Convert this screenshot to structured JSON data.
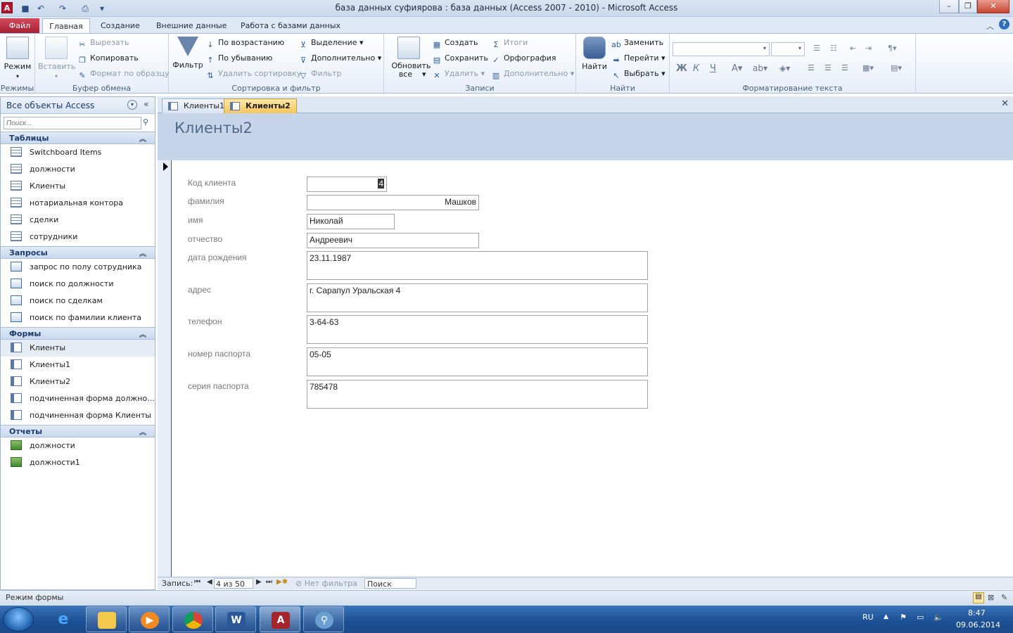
{
  "window": {
    "title": "база данных суфиярова : база данных (Access 2007 - 2010)  -  Microsoft Access",
    "app_icon_letter": "A"
  },
  "ribbon_tabs": [
    "Файл",
    "Главная",
    "Создание",
    "Внешние данные",
    "Работа с базами данных"
  ],
  "ribbon": {
    "views": {
      "label": "Режим",
      "group": "Режимы"
    },
    "clipboard": {
      "paste": "Вставить",
      "cut": "Вырезать",
      "copy": "Копировать",
      "format_painter": "Формат по образцу",
      "group": "Буфер обмена"
    },
    "sort_filter": {
      "filter": "Фильтр",
      "ascending": "По возрастанию",
      "descending": "По убыванию",
      "remove_sort": "Удалить сортировку",
      "selection": "Выделение",
      "advanced": "Дополнительно",
      "toggle_filter": "Фильтр",
      "group": "Сортировка и фильтр"
    },
    "records": {
      "refresh": "Обновить все",
      "new": "Создать",
      "save": "Сохранить",
      "delete": "Удалить",
      "totals": "Итоги",
      "spelling": "Орфография",
      "more": "Дополнительно",
      "group": "Записи"
    },
    "find": {
      "find": "Найти",
      "replace": "Заменить",
      "goto": "Перейти",
      "select": "Выбрать",
      "group": "Найти"
    },
    "text_format": {
      "bold": "Ж",
      "italic": "К",
      "underline": "Ч",
      "group": "Форматирование текста"
    }
  },
  "nav": {
    "title": "Все объекты Access",
    "search_placeholder": "Поиск...",
    "groups": [
      {
        "label": "Таблицы",
        "items": [
          "Switchboard Items",
          "должности",
          "Клиенты",
          "нотариальная контора",
          "сделки",
          "сотрудники"
        ]
      },
      {
        "label": "Запросы",
        "items": [
          "запрос по полу сотрудника",
          "поиск по должности",
          "поиск по сделкам",
          "поиск по фамилии клиента"
        ]
      },
      {
        "label": "Формы",
        "items": [
          "Клиенты",
          "Клиенты1",
          "Клиенты2",
          "подчиненная форма должно...",
          "подчиненная форма Клиенты"
        ]
      },
      {
        "label": "Отчеты",
        "items": [
          "должности",
          "должности1"
        ]
      }
    ]
  },
  "doc_tabs": [
    "Клиенты1",
    "Клиенты2"
  ],
  "form": {
    "title": "Клиенты2",
    "fields": [
      {
        "label": "Код клиента",
        "value": "4"
      },
      {
        "label": "фамилия",
        "value": "Машков"
      },
      {
        "label": "имя",
        "value": "Николай"
      },
      {
        "label": "отчество",
        "value": "Андреевич"
      },
      {
        "label": "дата рождения",
        "value": "23.11.1987"
      },
      {
        "label": "адрес",
        "value": "г. Сарапул Уральская 4"
      },
      {
        "label": "телефон",
        "value": "3-64-63"
      },
      {
        "label": "номер паспорта",
        "value": "05-05"
      },
      {
        "label": "серия паспорта",
        "value": "785478"
      }
    ]
  },
  "record_nav": {
    "label": "Запись:",
    "position": "4 из 50",
    "filter": "Нет фильтра",
    "search": "Поиск"
  },
  "status": {
    "mode": "Режим формы"
  },
  "taskbar": {
    "lang": "RU",
    "time": "8:47",
    "date": "09.06.2014"
  }
}
